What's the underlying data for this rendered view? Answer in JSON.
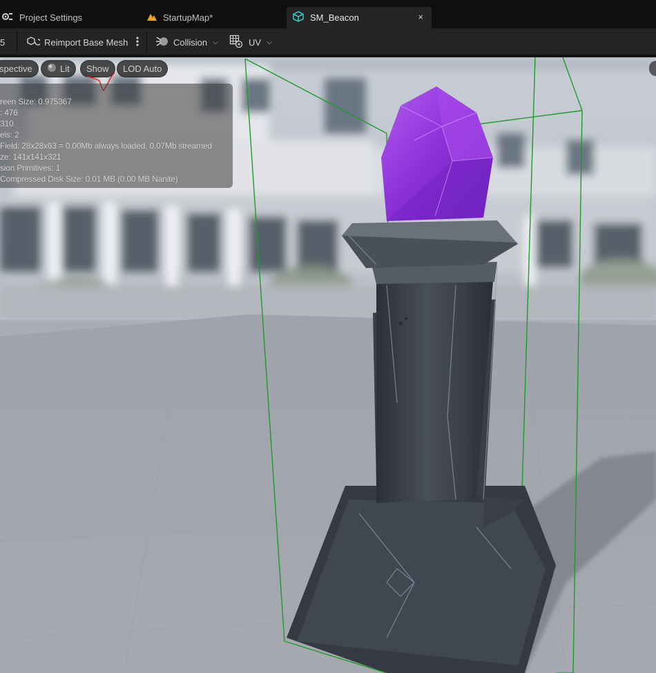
{
  "tabs": [
    {
      "label": "Project Settings",
      "icon": "settings-icon",
      "active": false
    },
    {
      "label": "StartupMap*",
      "icon": "map-icon",
      "active": false
    },
    {
      "label": "SM_Beacon",
      "icon": "static-mesh-icon",
      "active": true
    }
  ],
  "tab_close": "×",
  "toolbar": {
    "left_fragment": "5",
    "reimport_label": "Reimport Base Mesh",
    "collision_label": "Collision",
    "uv_label": "UV"
  },
  "viewport": {
    "perspective_label": "spective",
    "lit_label": "Lit",
    "show_label": "Show",
    "lod_label": "LOD Auto"
  },
  "stats": [
    "reen Size:  0.975367",
    ":  476",
    "310",
    "els:  2",
    "Field:  28x28x63 = 0.00Mb always loaded, 0.07Mb streamed",
    "ze: 141x141x321",
    "sion Primitives:  1",
    " Compressed Disk Size: 0.01 MB (0.00 MB Nanite)"
  ],
  "colors": {
    "accent_green": "#1e9a2a",
    "crystal": "#8a2fd8",
    "tab_active": "#242424",
    "map_icon": "#e8a020",
    "mesh_icon": "#35c6c6"
  }
}
